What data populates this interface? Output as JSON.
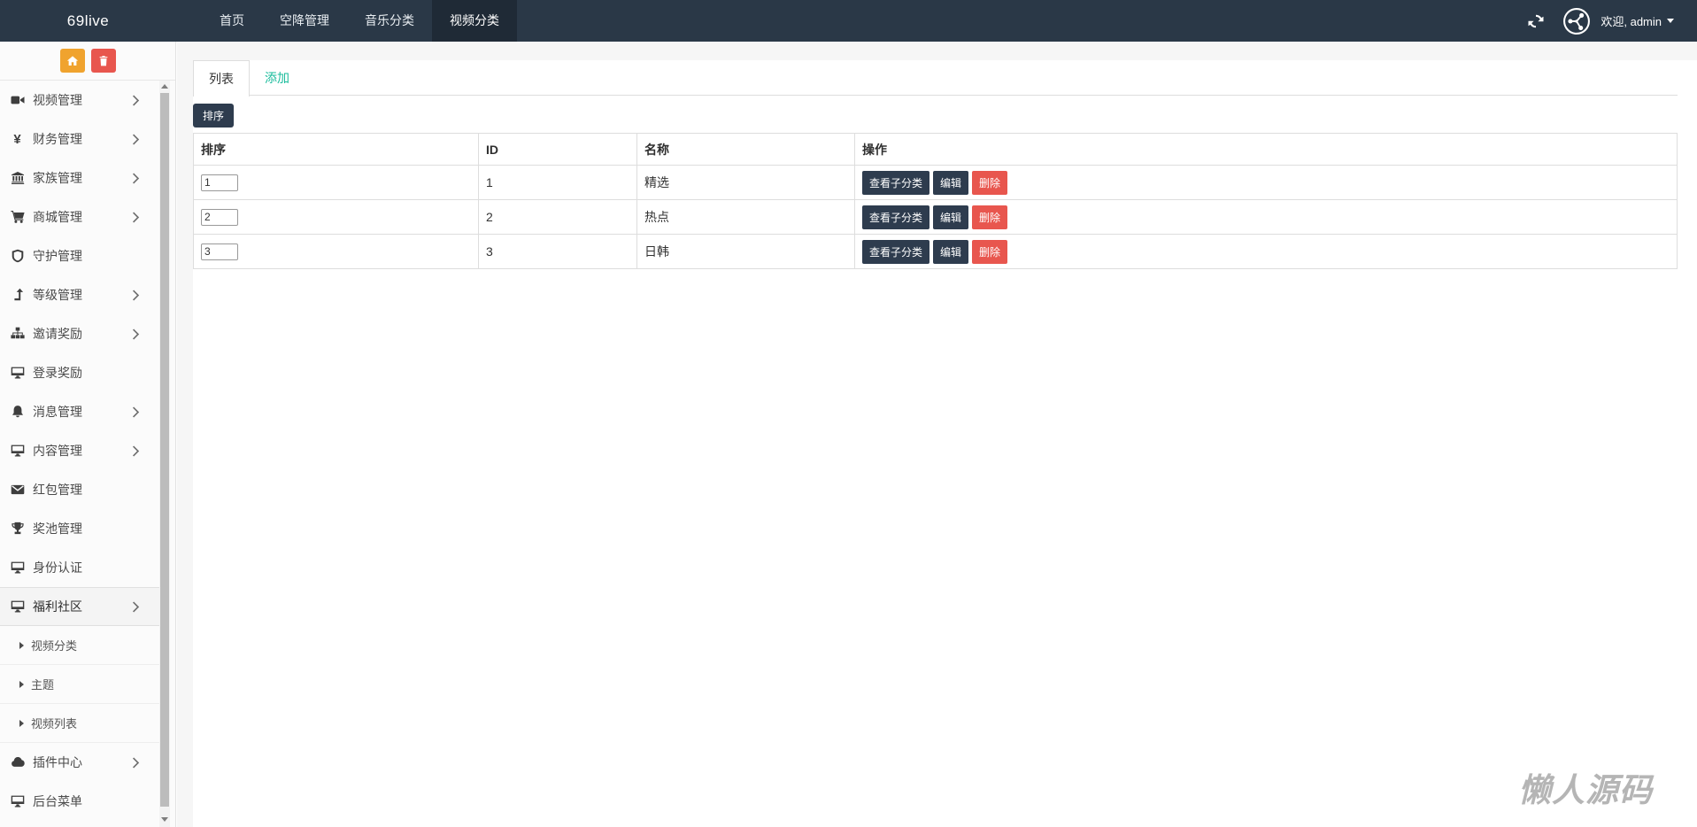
{
  "topbar": {
    "logo": "69live",
    "nav_items": [
      {
        "name": "home",
        "label": "首页",
        "active": false
      },
      {
        "name": "airdrop-management",
        "label": "空降管理",
        "active": false
      },
      {
        "name": "music-category",
        "label": "音乐分类",
        "active": false
      },
      {
        "name": "video-category",
        "label": "视频分类",
        "active": true
      }
    ],
    "icons": {
      "refresh": "refresh-icon",
      "avatar": "share-network-avatar-icon",
      "caret": "caret-down-icon"
    },
    "welcome_text": "欢迎, admin"
  },
  "sidebar": {
    "action_buttons": [
      {
        "name": "home",
        "icon": "home-icon",
        "color": "#f0a32e"
      },
      {
        "name": "trash",
        "icon": "trash-icon",
        "color": "#e8564e"
      }
    ],
    "items": [
      {
        "name": "video-management",
        "label": "视频管理",
        "icon": "video-camera-icon",
        "chevron": true
      },
      {
        "name": "finance-management",
        "label": "财务管理",
        "icon": "yen-icon",
        "chevron": true
      },
      {
        "name": "family-management",
        "label": "家族管理",
        "icon": "bank-icon",
        "chevron": true
      },
      {
        "name": "mall-management",
        "label": "商城管理",
        "icon": "cart-icon",
        "chevron": true
      },
      {
        "name": "guardian-management",
        "label": "守护管理",
        "icon": "shield-icon",
        "chevron": false
      },
      {
        "name": "level-management",
        "label": "等级管理",
        "icon": "level-up-icon",
        "chevron": true
      },
      {
        "name": "invite-rewards",
        "label": "邀请奖励",
        "icon": "sitemap-icon",
        "chevron": true
      },
      {
        "name": "login-rewards",
        "label": "登录奖励",
        "icon": "desktop-icon",
        "chevron": false
      },
      {
        "name": "message-management",
        "label": "消息管理",
        "icon": "bell-icon",
        "chevron": true
      },
      {
        "name": "content-management",
        "label": "内容管理",
        "icon": "desktop-icon",
        "chevron": true
      },
      {
        "name": "redpacket-management",
        "label": "红包管理",
        "icon": "envelope-icon",
        "chevron": false
      },
      {
        "name": "jackpot-management",
        "label": "奖池管理",
        "icon": "trophy-icon",
        "chevron": false
      },
      {
        "name": "identity-verification",
        "label": "身份认证",
        "icon": "desktop-icon",
        "chevron": false
      },
      {
        "name": "welfare-community",
        "label": "福利社区",
        "icon": "desktop-icon",
        "chevron": true,
        "active": true
      },
      {
        "name": "video-category",
        "label": "视频分类",
        "sub": true
      },
      {
        "name": "theme",
        "label": "主题",
        "sub": true
      },
      {
        "name": "video-list",
        "label": "视频列表",
        "sub": true
      },
      {
        "name": "plugin-center",
        "label": "插件中心",
        "icon": "cloud-icon",
        "chevron": true
      },
      {
        "name": "admin-menu",
        "label": "后台菜单",
        "icon": "desktop-icon",
        "chevron": false
      }
    ]
  },
  "main": {
    "tabs": [
      {
        "name": "list",
        "label": "列表",
        "active": true
      },
      {
        "name": "add",
        "label": "添加",
        "active": false
      }
    ],
    "sort_button_label": "排序",
    "table": {
      "headers": [
        "排序",
        "ID",
        "名称",
        "操作"
      ],
      "rows": [
        {
          "sort_input": "1",
          "id": "1",
          "name": "精选"
        },
        {
          "sort_input": "2",
          "id": "2",
          "name": "热点"
        },
        {
          "sort_input": "3",
          "id": "3",
          "name": "日韩"
        }
      ],
      "row_actions": [
        {
          "name": "view-subcategories",
          "label": "查看子分类",
          "style": "dark"
        },
        {
          "name": "edit",
          "label": "编辑",
          "style": "dark"
        },
        {
          "name": "delete",
          "label": "删除",
          "style": "red"
        }
      ]
    }
  },
  "watermark": "懒人源码",
  "colors": {
    "topbar_bg": "#2a3847",
    "topbar_active_bg": "#1f2a36",
    "accent_teal": "#1abc9c",
    "button_dark": "#2e3c4e",
    "button_red": "#e8564e",
    "home_button_orange": "#f0a32e",
    "trash_button_red": "#e8564e"
  }
}
